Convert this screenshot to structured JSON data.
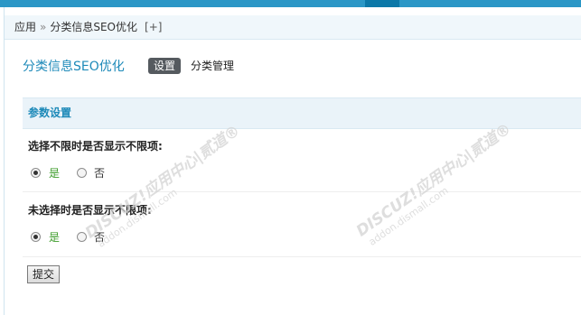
{
  "breadcrumb": {
    "root": "应用",
    "separator": "»",
    "current": "分类信息SEO优化",
    "add": "[+]"
  },
  "header": {
    "title": "分类信息SEO优化",
    "tabs": [
      {
        "label": "设置",
        "active": true
      },
      {
        "label": "分类管理",
        "active": false
      }
    ]
  },
  "section": {
    "title": "参数设置"
  },
  "options": [
    {
      "label": "选择不限时是否显示不限项:",
      "yes": "是",
      "no": "否",
      "selected": "是"
    },
    {
      "label": "未选择时是否显示不限项:",
      "yes": "是",
      "no": "否",
      "selected": "是"
    }
  ],
  "submit_label": "提交",
  "watermark": {
    "brand": "DISCUZ!应用中心|贰道®",
    "url": "addon.dismall.com"
  },
  "colors": {
    "accent": "#1e8ab9",
    "topbar": "#2b97c6",
    "yes_text": "#3e9c2b"
  }
}
